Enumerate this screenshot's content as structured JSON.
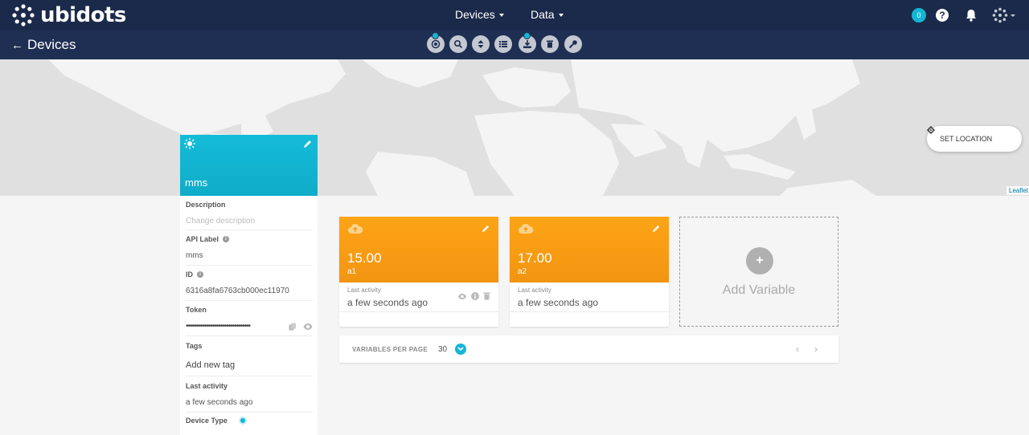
{
  "brand": {
    "name": "ubidots"
  },
  "nav": {
    "devices_label": "Devices",
    "data_label": "Data"
  },
  "top_right": {
    "notification_count": "0",
    "help_glyph": "?"
  },
  "subbar": {
    "back_arrow": "←",
    "title": "Devices"
  },
  "map": {
    "set_location_label": "SET LOCATION",
    "attribution": "Leaflet"
  },
  "device": {
    "name": "mms",
    "description_label": "Description",
    "description_placeholder": "Change description",
    "api_label_label": "API Label",
    "api_label_value": "mms",
    "id_label": "ID",
    "id_value": "6316a8fa6763cb000ec11970",
    "token_label": "Token",
    "token_value": "••••••••••••••••••••••••••••••••",
    "tags_label": "Tags",
    "tags_placeholder": "Add new tag",
    "last_activity_label": "Last activity",
    "last_activity_value": "a few seconds ago",
    "device_type_label": "Device Type",
    "info_glyph": "i"
  },
  "variables": [
    {
      "value": "15.00",
      "label": "a1",
      "last_activity_label": "Last activity",
      "last_activity_value": "a few seconds ago"
    },
    {
      "value": "17.00",
      "label": "a2",
      "last_activity_label": "Last activity",
      "last_activity_value": "a few seconds ago"
    }
  ],
  "add_variable": {
    "plus": "+",
    "label": "Add Variable"
  },
  "pager": {
    "label": "VARIABLES PER PAGE",
    "count": "30",
    "prev": "‹",
    "next": "›"
  },
  "colors": {
    "navbar": "#1b2a4a",
    "accent": "#14b6d5",
    "variable_card": "#fea416",
    "device_card": "#14bcd8"
  }
}
